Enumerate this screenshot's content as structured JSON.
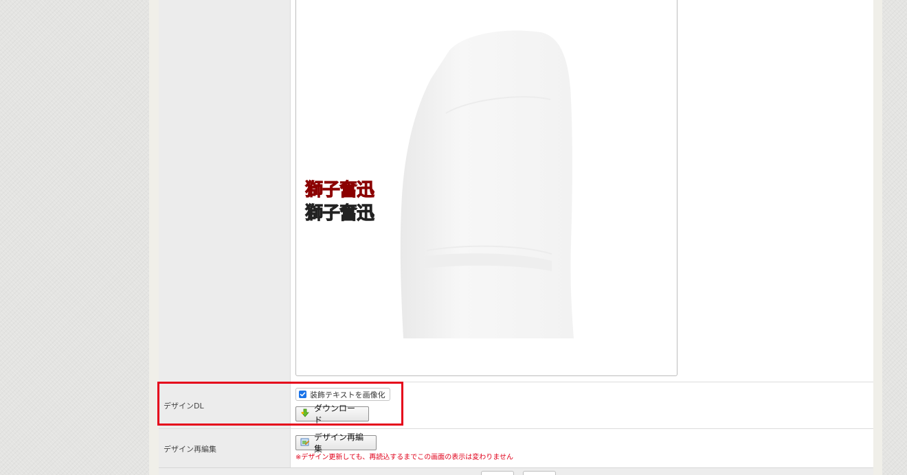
{
  "rows": {
    "design_dl": {
      "label": "デザインDL",
      "checkbox_label": "装飾テキストを画像化",
      "checkbox_checked": true,
      "download_label": "ダウンロード"
    },
    "design_reedit": {
      "label": "デザイン再編集",
      "button_label": "デザイン再編集",
      "note": "※デザイン更新しても、再読込するまでこの画面の表示は変わりません"
    }
  },
  "preview": {
    "text_red": "獅子奮迅",
    "text_gray": "獅子奮迅"
  },
  "colors": {
    "highlight": "#e5001a",
    "note": "#e0001a",
    "checkbox": "#1a73e8",
    "kanji_red": "#d41f24",
    "kanji_gray": "#4a4a4a"
  },
  "icons": {
    "download": "download-arrow-icon",
    "reedit": "edit-design-icon"
  }
}
